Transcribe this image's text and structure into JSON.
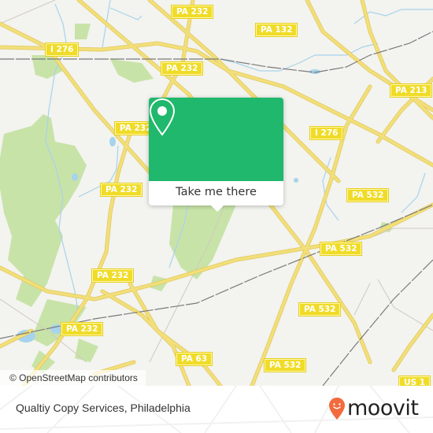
{
  "map": {
    "road_labels": [
      {
        "id": "pa232-top",
        "text": "PA 232"
      },
      {
        "id": "pa132",
        "text": "PA 132"
      },
      {
        "id": "i276-left",
        "text": "I 276"
      },
      {
        "id": "pa232-mid",
        "text": "PA 232"
      },
      {
        "id": "pa213",
        "text": "PA 213"
      },
      {
        "id": "pa232-a",
        "text": "PA 232"
      },
      {
        "id": "i276-right",
        "text": "I 276"
      },
      {
        "id": "pa232-b",
        "text": "PA 232"
      },
      {
        "id": "pa532-a",
        "text": "PA 532"
      },
      {
        "id": "pa532-b",
        "text": "PA 532"
      },
      {
        "id": "pa232-c",
        "text": "PA 232"
      },
      {
        "id": "pa232-d",
        "text": "PA 232"
      },
      {
        "id": "pa532-c",
        "text": "PA 532"
      },
      {
        "id": "pa63",
        "text": "PA 63"
      },
      {
        "id": "pa532-d",
        "text": "PA 532"
      },
      {
        "id": "us1",
        "text": "US 1"
      }
    ],
    "attribution": "© OpenStreetMap contributors",
    "colors": {
      "background": "#f3f3ef",
      "road": "#f2df7a",
      "road_casing": "#e0c85a",
      "park": "#c8e3a8",
      "water": "#a7d3ec",
      "rail": "#7a7a7a",
      "shield": "#f0dc28"
    }
  },
  "popup": {
    "icon": "map-pin-icon",
    "cta_label": "Take me there",
    "color": "#1fb86c"
  },
  "footer": {
    "place_name": "Qualtiy Copy Services, Philadelphia",
    "logo_text": "moovit",
    "logo_icon": "moovit-pin-icon",
    "logo_color": "#f26a3d"
  }
}
